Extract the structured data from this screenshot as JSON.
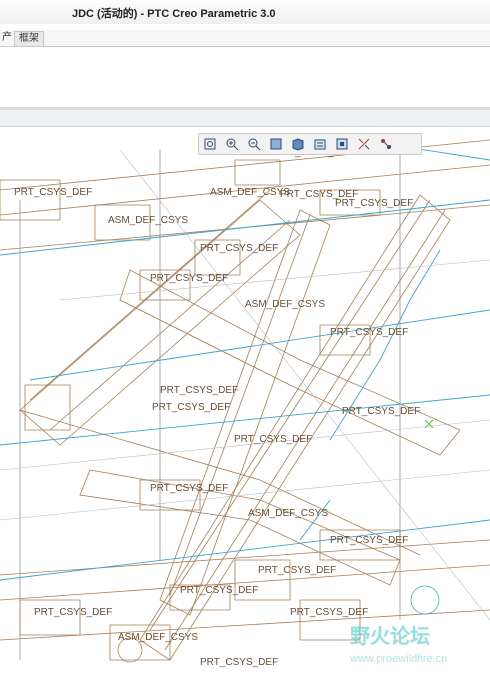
{
  "window": {
    "title": "JDC (活动的) - PTC Creo Parametric 3.0"
  },
  "tabs": [
    {
      "label": "产"
    },
    {
      "label": "框架"
    }
  ],
  "view_toolbar": {
    "icons": [
      "refit-icon",
      "zoom-in-icon",
      "zoom-out-icon",
      "repaint-icon",
      "display-style-icon",
      "saved-views-icon",
      "view-manager-icon",
      "datum-display-icon",
      "annotation-display-icon"
    ]
  },
  "model_labels": [
    "PRT_CSYS_DEF",
    "ASM_DEF_CSYS",
    "PRT_CSYS_DEF",
    "PRT_CSYS_DEF",
    "PRT_CSYS_DEF",
    "PRT_CSYS_DEF",
    "ASM_DEF_CSYS",
    "PRT_CSYS_DEF",
    "PRT_CSYS_DEF",
    "PRT_CSYS_DEF",
    "PRT_CSYS_DEF",
    "ASM_DEF_CSYS",
    "PRT_CSYS_DEF",
    "PRT_CSYS_DEF",
    "PRT_CSYS_DEF",
    "PRT_CSYS_DEF",
    "PRT_CSYS_DEF",
    "ASM_DEF_CSYS",
    "PRT_CSYS_DEF",
    "PRT_CSYS_DEF",
    "PRT_CSYS_DEF",
    "ASM_DEF_CSYS",
    "PRT_CSYS_DEF"
  ],
  "watermark": {
    "title": "野火论坛",
    "url": "www.proewildfire.cn"
  },
  "colors": {
    "wire": "#a4764a",
    "datum_blue": "#3aa6cf",
    "axis_gray": "#8a8f99"
  }
}
